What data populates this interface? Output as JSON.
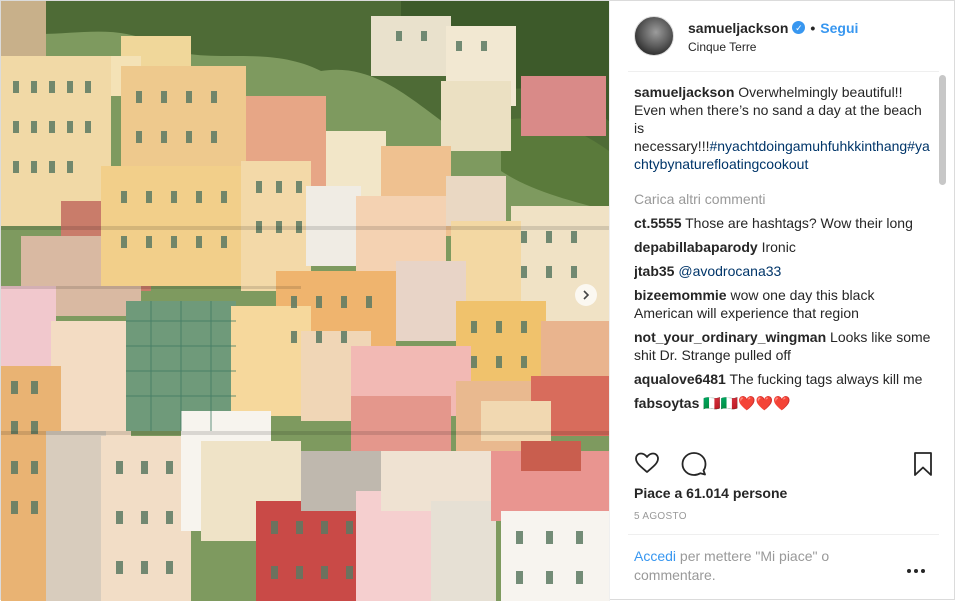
{
  "post": {
    "username": "samueljackson",
    "follow_label": "Segui",
    "location": "Cinque Terre",
    "caption_text": " Overwhelmingly beautiful!! Even when there’s no sand a day at the beach is necessary!!!",
    "hashtags": "#nyachtdoingamuhfuhkkinthang#yachtybynaturefloatingcookout",
    "load_more": "Carica altri commenti",
    "likes": "Piace a 61.014 persone",
    "date": "5 AGOSTO",
    "login_link": "Accedi",
    "login_text": " per mettere \"Mi piace\" o commentare."
  },
  "comments": [
    {
      "user": "ct.5555",
      "text": " Those are hashtags? Wow their long"
    },
    {
      "user": "depabillabaparody",
      "text": " Ironic"
    },
    {
      "user": "jtab35",
      "mention": "@avodrocana33"
    },
    {
      "user": "bizeemommie",
      "text": " wow one day this black American will experience that region"
    },
    {
      "user": "not_your_ordinary_wingman",
      "text": " Looks like some shit Dr. Strange pulled off"
    },
    {
      "user": "aqualove6481",
      "text": " The fucking tags always kill me"
    },
    {
      "user": "fabsoytas",
      "text": " 🇮🇹🇮🇹❤️❤️❤️"
    }
  ],
  "icons": {
    "verified": "verified-badge-icon",
    "like": "heart-icon",
    "comment": "comment-bubble-icon",
    "save": "bookmark-icon",
    "more": "more-options-icon",
    "next": "chevron-right-icon"
  },
  "colors": {
    "link": "#3897f0",
    "hashtag": "#003569",
    "muted": "#999999",
    "text": "#262626"
  }
}
